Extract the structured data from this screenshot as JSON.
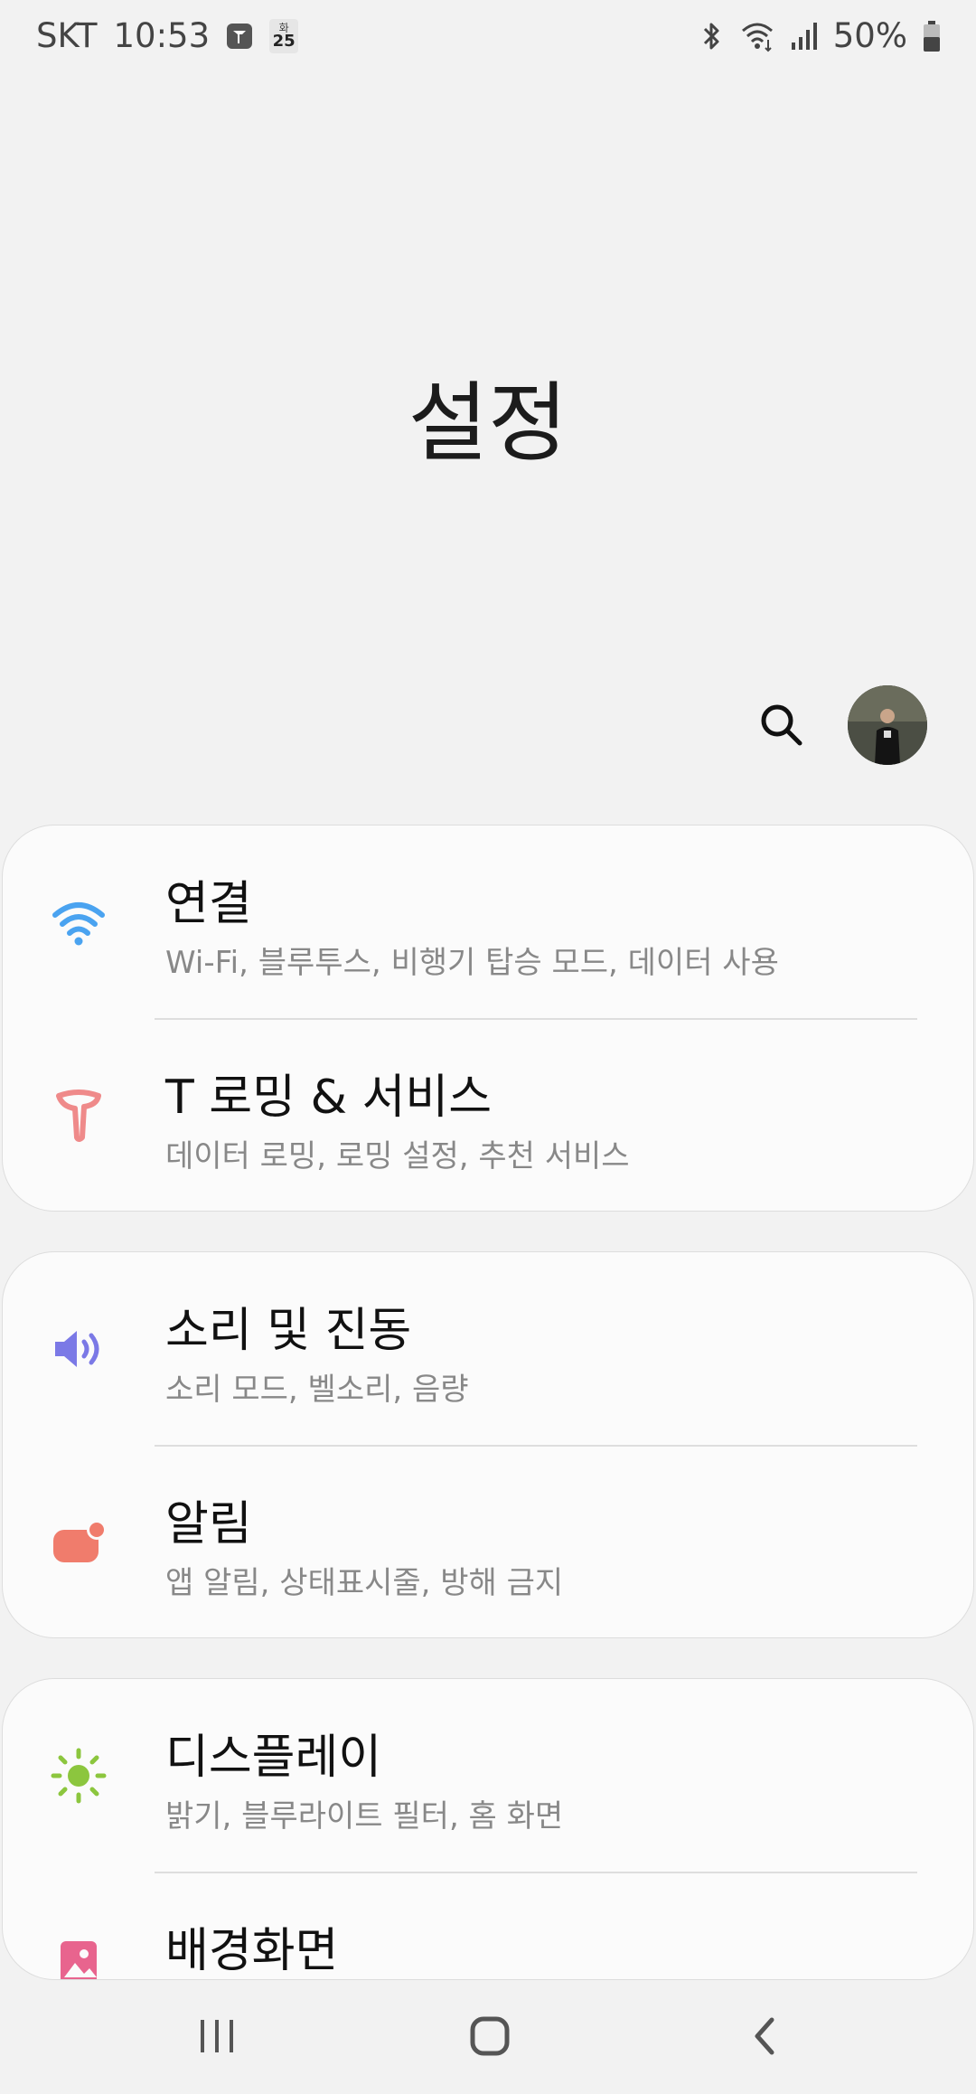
{
  "status_bar": {
    "carrier": "SKT",
    "time": "10:53",
    "calendar_day_label": "화",
    "calendar_date": "25",
    "battery": "50%"
  },
  "page": {
    "title": "설정"
  },
  "colors": {
    "wifi": "#4aa3f0",
    "t_roaming": "#ef8a8a",
    "sound": "#7b79e6",
    "notifications": "#f07c6c",
    "display": "#8cc63e",
    "wallpaper": "#e8648e"
  },
  "settings": [
    {
      "title": "연결",
      "subtitle": "Wi-Fi, 블루투스, 비행기 탑승 모드, 데이터 사용",
      "icon": "wifi-icon"
    },
    {
      "title": "T 로밍 & 서비스",
      "subtitle": "데이터 로밍, 로밍 설정, 추천 서비스",
      "icon": "t-logo-icon"
    },
    {
      "title": "소리 및 진동",
      "subtitle": "소리 모드, 벨소리, 음량",
      "icon": "speaker-icon"
    },
    {
      "title": "알림",
      "subtitle": "앱 알림, 상태표시줄, 방해 금지",
      "icon": "notification-icon"
    },
    {
      "title": "디스플레이",
      "subtitle": "밝기, 블루라이트 필터, 홈 화면",
      "icon": "sun-icon"
    },
    {
      "title": "배경화면",
      "subtitle": "",
      "icon": "wallpaper-icon"
    }
  ],
  "nav": {
    "recents": "recents-icon",
    "home": "home-icon",
    "back": "back-icon"
  }
}
